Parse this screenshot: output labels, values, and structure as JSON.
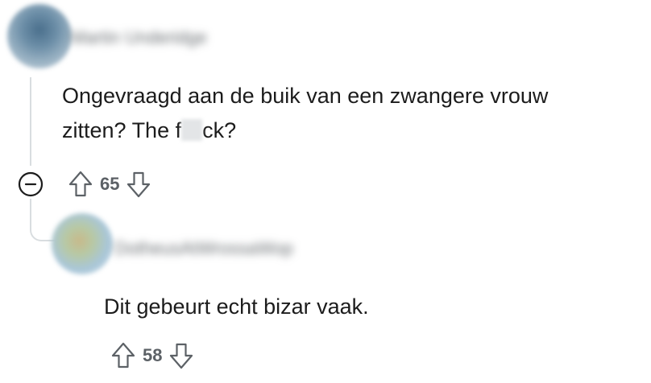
{
  "comments": [
    {
      "author": "Martin Underidge",
      "body_line1": "Ongevraagd aan de buik van een zwangere vrouw",
      "body_line2_before": "zitten? The f",
      "body_line2_after": "ck?",
      "score": "65"
    },
    {
      "author": "DotheusAtWrossaWop",
      "body": "Dit gebeurt echt bizar vaak.",
      "score": "58"
    }
  ],
  "colors": {
    "text": "#1c1c1c",
    "meta": "#5c6166",
    "thread_line": "#d9dde0"
  },
  "icons": {
    "upvote": "arrow-up-outline",
    "downvote": "arrow-down-outline",
    "collapse": "minus-circle"
  }
}
